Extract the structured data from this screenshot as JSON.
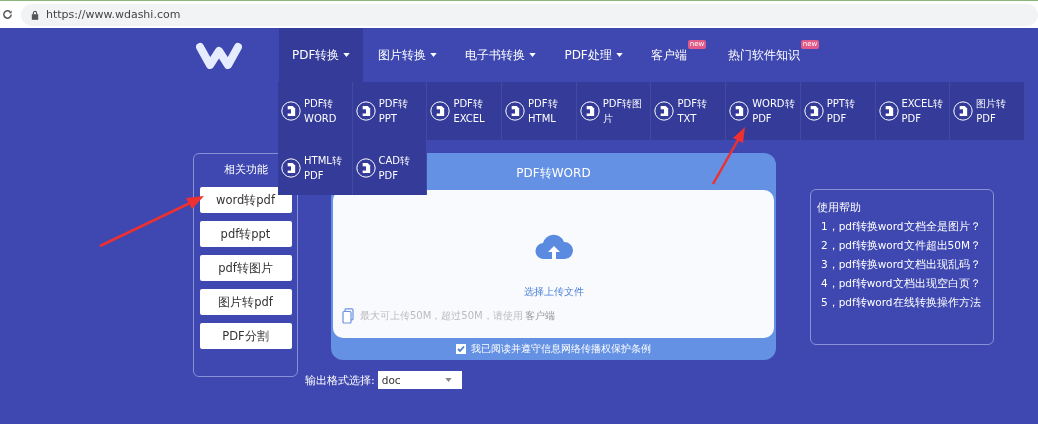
{
  "browser": {
    "url": "https://www.wdashi.com"
  },
  "nav": [
    {
      "label": "PDF转换",
      "selected": true,
      "dropdown": true
    },
    {
      "label": "图片转换",
      "selected": false,
      "dropdown": true
    },
    {
      "label": "电子书转换",
      "selected": false,
      "dropdown": true
    },
    {
      "label": "PDF处理",
      "selected": false,
      "dropdown": true
    },
    {
      "label": "客户端",
      "selected": false,
      "dropdown": false,
      "badge": "new"
    },
    {
      "label": "热门软件知识",
      "selected": false,
      "dropdown": false,
      "badge": "new"
    }
  ],
  "menu": [
    {
      "lines": [
        "PDF转",
        "WORD"
      ]
    },
    {
      "lines": [
        "PDF转",
        "PPT"
      ]
    },
    {
      "lines": [
        "PDF转",
        "EXCEL"
      ]
    },
    {
      "lines": [
        "PDF转",
        "HTML"
      ]
    },
    {
      "lines": [
        "PDF转图",
        "片"
      ]
    },
    {
      "lines": [
        "PDF转",
        "TXT"
      ]
    },
    {
      "lines": [
        "WORD转",
        "PDF"
      ]
    },
    {
      "lines": [
        "PPT转",
        "PDF"
      ]
    },
    {
      "lines": [
        "EXCEL转",
        "PDF"
      ]
    },
    {
      "lines": [
        "图片转",
        "PDF"
      ]
    },
    {
      "lines": [
        "HTML转",
        "PDF"
      ]
    },
    {
      "lines": [
        "CAD转",
        "PDF"
      ]
    }
  ],
  "related": {
    "title": "相关功能",
    "items": [
      "word转pdf",
      "pdf转ppt",
      "pdf转图片",
      "图片转pdf",
      "PDF分割"
    ]
  },
  "converter": {
    "title": "PDF转WORD",
    "upload_label": "选择上传文件",
    "limit_note": "最大可上传50M，超过50M，请使用",
    "client_link": "客户端",
    "agreement": {
      "label": "我已阅读并遵守信息网络传播权保护条例",
      "checked": true
    }
  },
  "format": {
    "label": "输出格式选择:",
    "value": "doc"
  },
  "help": {
    "title": "使用帮助",
    "items": [
      "1，pdf转换word文档全是图片？",
      "2，pdf转换word文件超出50M？",
      "3，pdf转换word文档出现乱码？",
      "4，pdf转word文档出现空白页？",
      "5，pdf转word在线转换操作方法"
    ]
  }
}
